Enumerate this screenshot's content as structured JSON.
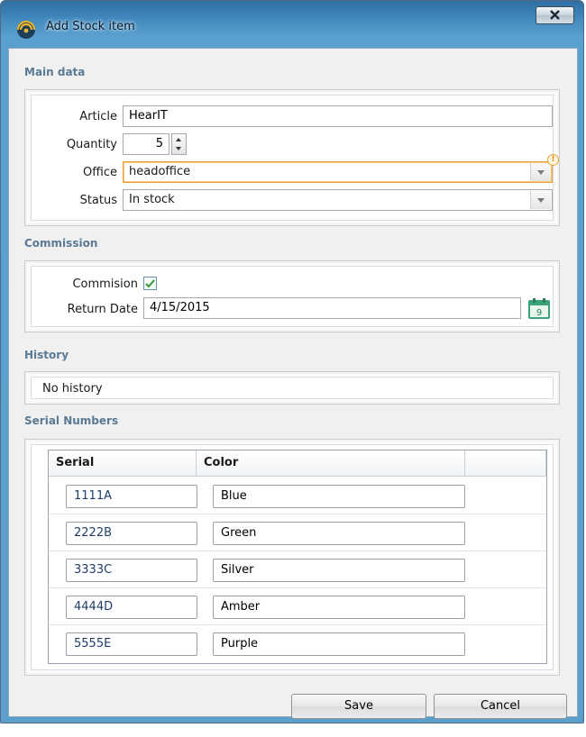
{
  "window": {
    "title": "Add Stock item"
  },
  "main_data": {
    "heading": "Main data",
    "article_label": "Article",
    "article_value": "HearIT",
    "quantity_label": "Quantity",
    "quantity_value": "5",
    "office_label": "Office",
    "office_value": "headoffice",
    "office_warning": "!",
    "status_label": "Status",
    "status_value": "In stock"
  },
  "commission": {
    "heading": "Commission",
    "commission_label": "Commision",
    "commission_checked": true,
    "return_date_label": "Return Date",
    "return_date_value": "4/15/2015",
    "calendar_day": "9"
  },
  "history": {
    "heading": "History",
    "text": "No history"
  },
  "serials": {
    "heading": "Serial Numbers",
    "columns": [
      "Serial",
      "Color"
    ],
    "rows": [
      {
        "serial": "1111A",
        "color": "Blue"
      },
      {
        "serial": "2222B",
        "color": "Green"
      },
      {
        "serial": "3333C",
        "color": "Silver"
      },
      {
        "serial": "4444D",
        "color": "Amber"
      },
      {
        "serial": "5555E",
        "color": "Purple"
      }
    ]
  },
  "actions": {
    "save": "Save",
    "cancel": "Cancel"
  },
  "colors": {
    "title_bar": "#3f86bb",
    "accent_focus": "#e9a33b",
    "section_heading": "#5a7a94",
    "calendar_green": "#3aa37a"
  }
}
